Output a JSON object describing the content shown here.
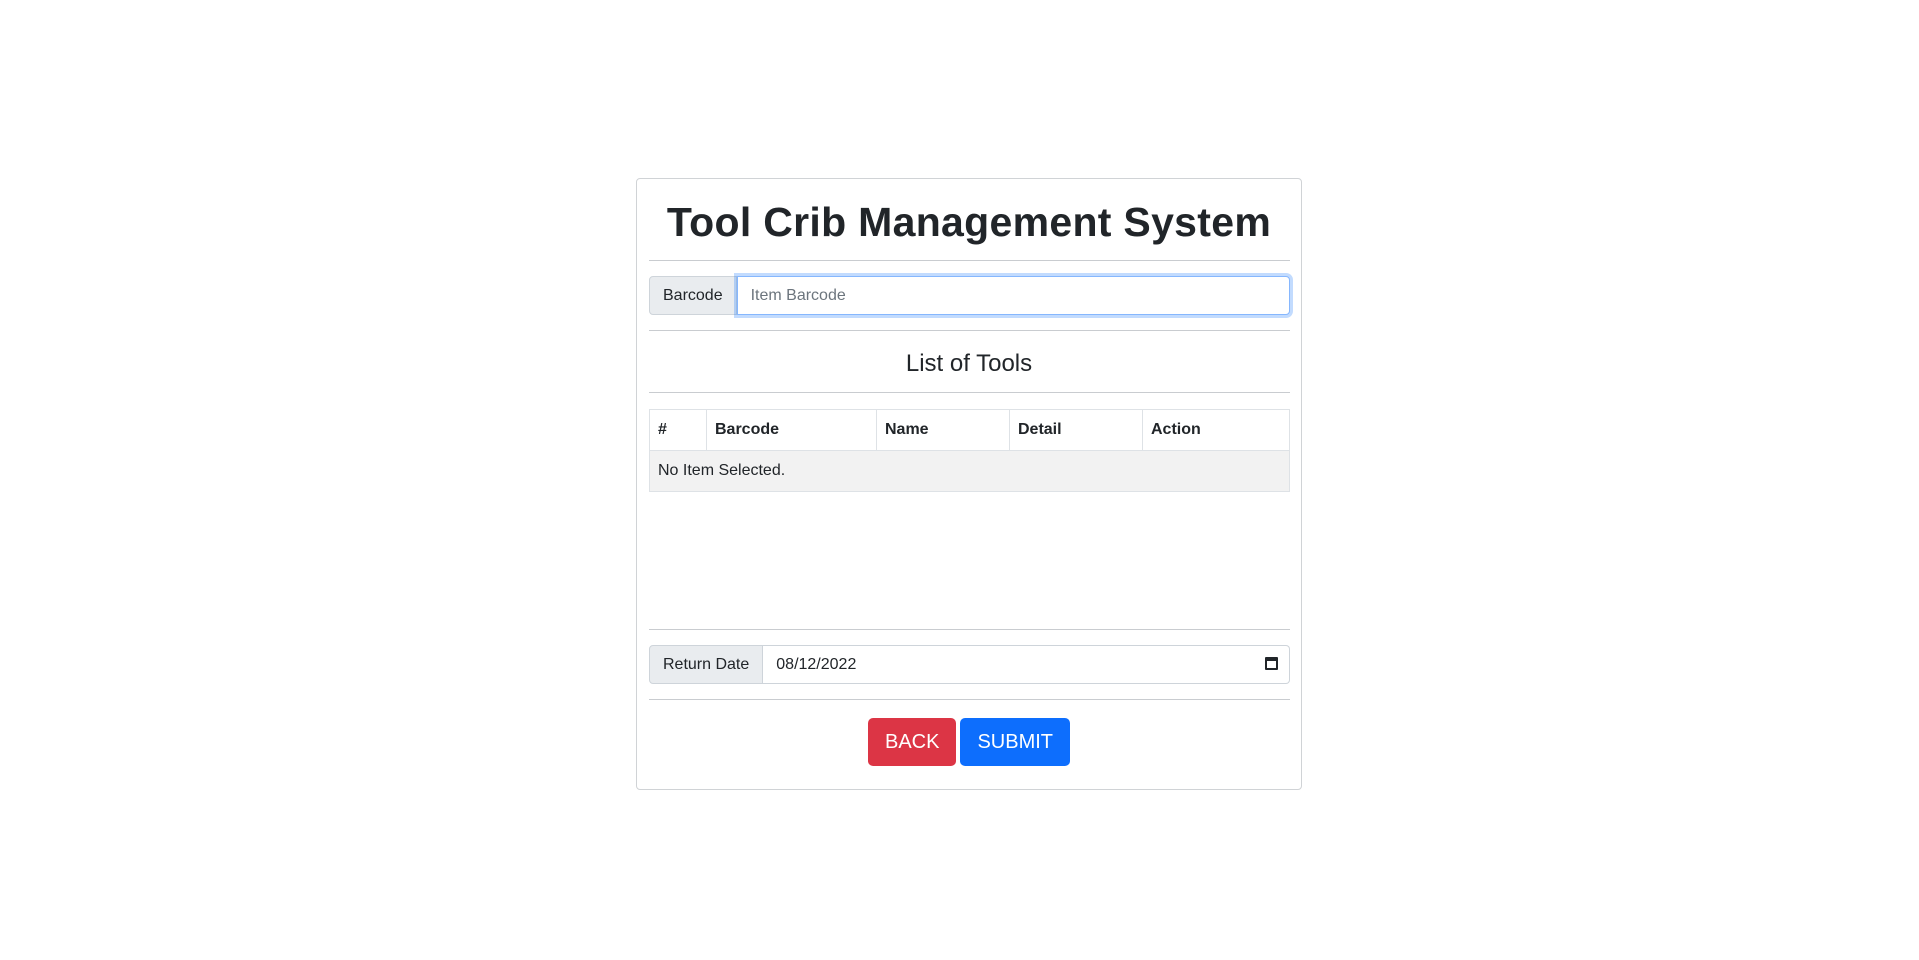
{
  "page": {
    "title": "Tool Crib Management System"
  },
  "barcode": {
    "label": "Barcode",
    "placeholder": "Item Barcode",
    "value": ""
  },
  "tools": {
    "title": "List of Tools",
    "columns": [
      "#",
      "Barcode",
      "Name",
      "Detail",
      "Action"
    ],
    "empty_message": "No Item Selected."
  },
  "return_date": {
    "label": "Return Date",
    "value": "08/12/2022",
    "icon": "calendar-icon"
  },
  "buttons": {
    "back_label": "BACK",
    "submit_label": "SUBMIT"
  },
  "colors": {
    "back": "#dc3545",
    "submit": "#0d6efd",
    "focus_ring": "#86b7fe"
  }
}
